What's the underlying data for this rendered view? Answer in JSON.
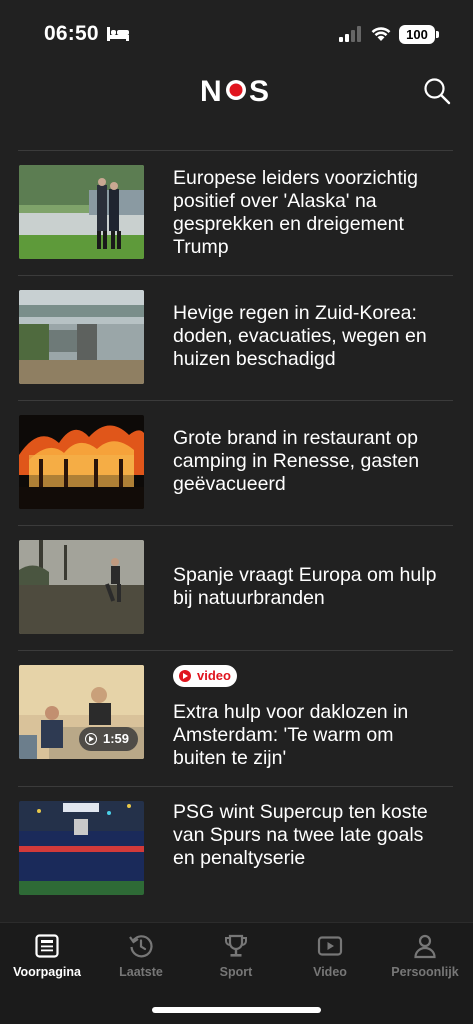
{
  "status_bar": {
    "time": "06:50",
    "battery": "100"
  },
  "header": {
    "logo": "NOS",
    "logo_colors": {
      "text": "#ffffff",
      "o": "#e0141e"
    }
  },
  "articles": [
    {
      "headline": "Europese leiders voorzichtig positief over 'Alaska' na gesprekken en dreigement Trump",
      "image": "leaders-walking-photo"
    },
    {
      "headline": "Hevige regen in Zuid-Korea: doden, evacuaties, wegen en huizen beschadigd",
      "image": "flooded-bridge-photo"
    },
    {
      "headline": "Grote brand in restaurant op camping in Renesse, gasten geëvacueerd",
      "image": "building-fire-photo"
    },
    {
      "headline": "Spanje vraagt Europa om hulp bij natuurbranden",
      "image": "wildfire-smoke-photo"
    },
    {
      "headline": "Extra hulp voor daklozen in Amsterdam: 'Te warm om buiten te zijn'",
      "image": "people-sitting-photo",
      "badge": "video",
      "duration": "1:59"
    },
    {
      "headline": "PSG wint Supercup ten koste van Spurs na twee late goals en penaltyserie",
      "image": "team-celebration-photo"
    }
  ],
  "tabs": [
    {
      "label": "Voorpagina",
      "icon": "newspaper-icon",
      "active": true
    },
    {
      "label": "Laatste",
      "icon": "history-icon",
      "active": false
    },
    {
      "label": "Sport",
      "icon": "trophy-icon",
      "active": false
    },
    {
      "label": "Video",
      "icon": "video-play-icon",
      "active": false
    },
    {
      "label": "Persoonlijk",
      "icon": "person-icon",
      "active": false
    }
  ],
  "colors": {
    "background": "#212121",
    "tabbar": "#1b1b1b",
    "accent_red": "#e0141e",
    "inactive_tab": "#777777"
  }
}
